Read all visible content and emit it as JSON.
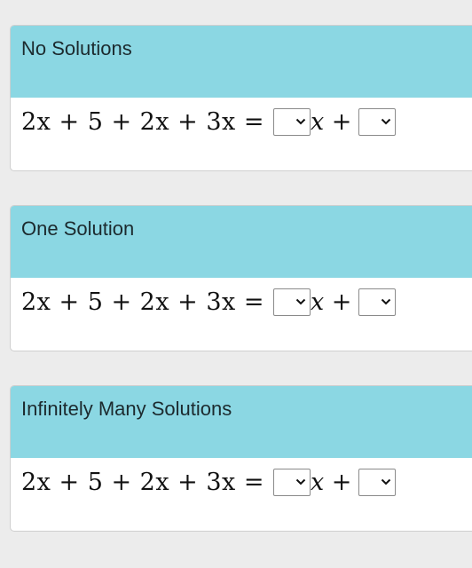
{
  "cards": [
    {
      "title": "No Solutions",
      "equation_lhs": "2x + 5 + 2x + 3x =",
      "coef_select_value": "",
      "var": "x",
      "plus": "+",
      "const_select_value": ""
    },
    {
      "title": "One Solution",
      "equation_lhs": "2x + 5 + 2x + 3x =",
      "coef_select_value": "",
      "var": "x",
      "plus": "+",
      "const_select_value": ""
    },
    {
      "title": "Infinitely Many Solutions",
      "equation_lhs": "2x + 5 + 2x + 3x =",
      "coef_select_value": "",
      "var": "x",
      "plus": "+",
      "const_select_value": ""
    }
  ],
  "icons": {
    "dropdown": "chevron-down-icon"
  },
  "colors": {
    "header_bg": "#8bd7e3",
    "page_bg": "#ececec"
  }
}
